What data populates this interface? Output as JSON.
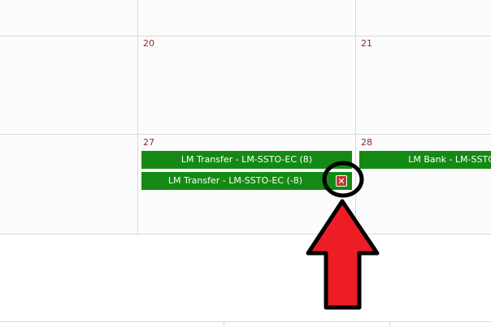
{
  "calendar": {
    "rows": [
      {
        "days": [
          "",
          "",
          ""
        ]
      },
      {
        "days": [
          "",
          "20",
          "21"
        ]
      },
      {
        "days": [
          "",
          "27",
          "28"
        ]
      },
      {
        "days": [
          "",
          "",
          ""
        ]
      }
    ],
    "events": [
      {
        "label": "LM Transfer - LM-SSTO-EC (8)",
        "color": "#148a14"
      },
      {
        "label": "LM Transfer - LM-SSTO-EC (-8)",
        "color": "#148a14",
        "close_icon": "x-delete-icon",
        "close_color": "#c0392b"
      },
      {
        "label": "LM Bank - LM-SSTO-EC",
        "color": "#148a14"
      }
    ],
    "day_number_color": "#8b2b2b"
  },
  "annotation": {
    "highlight_circle_icon": "highlight-circle-icon",
    "arrow_icon": "red-up-arrow-icon",
    "arrow_color": "#ee1c24"
  }
}
